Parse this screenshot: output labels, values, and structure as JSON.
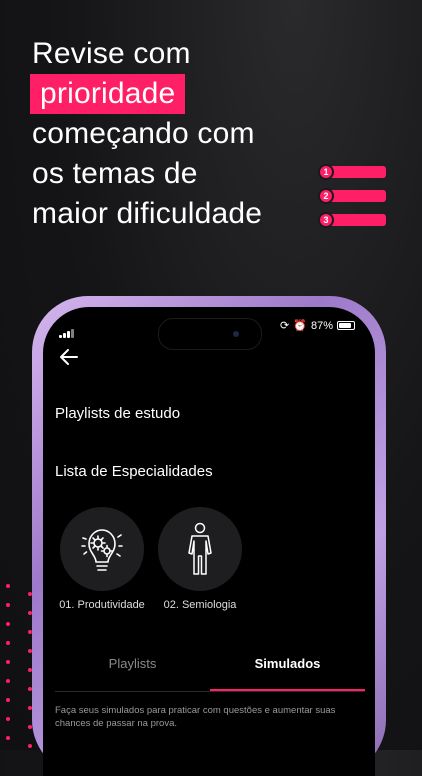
{
  "headline": {
    "line1": "Revise com",
    "highlight": "prioridade",
    "line3": "começando com",
    "line4": "os temas de",
    "line5": "maior dificuldade"
  },
  "decoration": {
    "numbers": [
      "1",
      "2",
      "3"
    ],
    "accent": "#ff1f66"
  },
  "status_bar": {
    "battery": "87%",
    "battery_level": 0.87
  },
  "app": {
    "section_playlists": "Playlists de estudo",
    "section_specialties": "Lista de Especialidades",
    "specialties": [
      {
        "label": "01. Produtividade",
        "icon": "lightbulb-gears-icon"
      },
      {
        "label": "02. Semiologia",
        "icon": "human-body-icon"
      }
    ],
    "tabs": [
      {
        "label": "Playlists",
        "active": false
      },
      {
        "label": "Simulados",
        "active": true
      }
    ],
    "description": "Faça seus simulados para praticar com questões e aumentar suas chances de passar na prova."
  }
}
